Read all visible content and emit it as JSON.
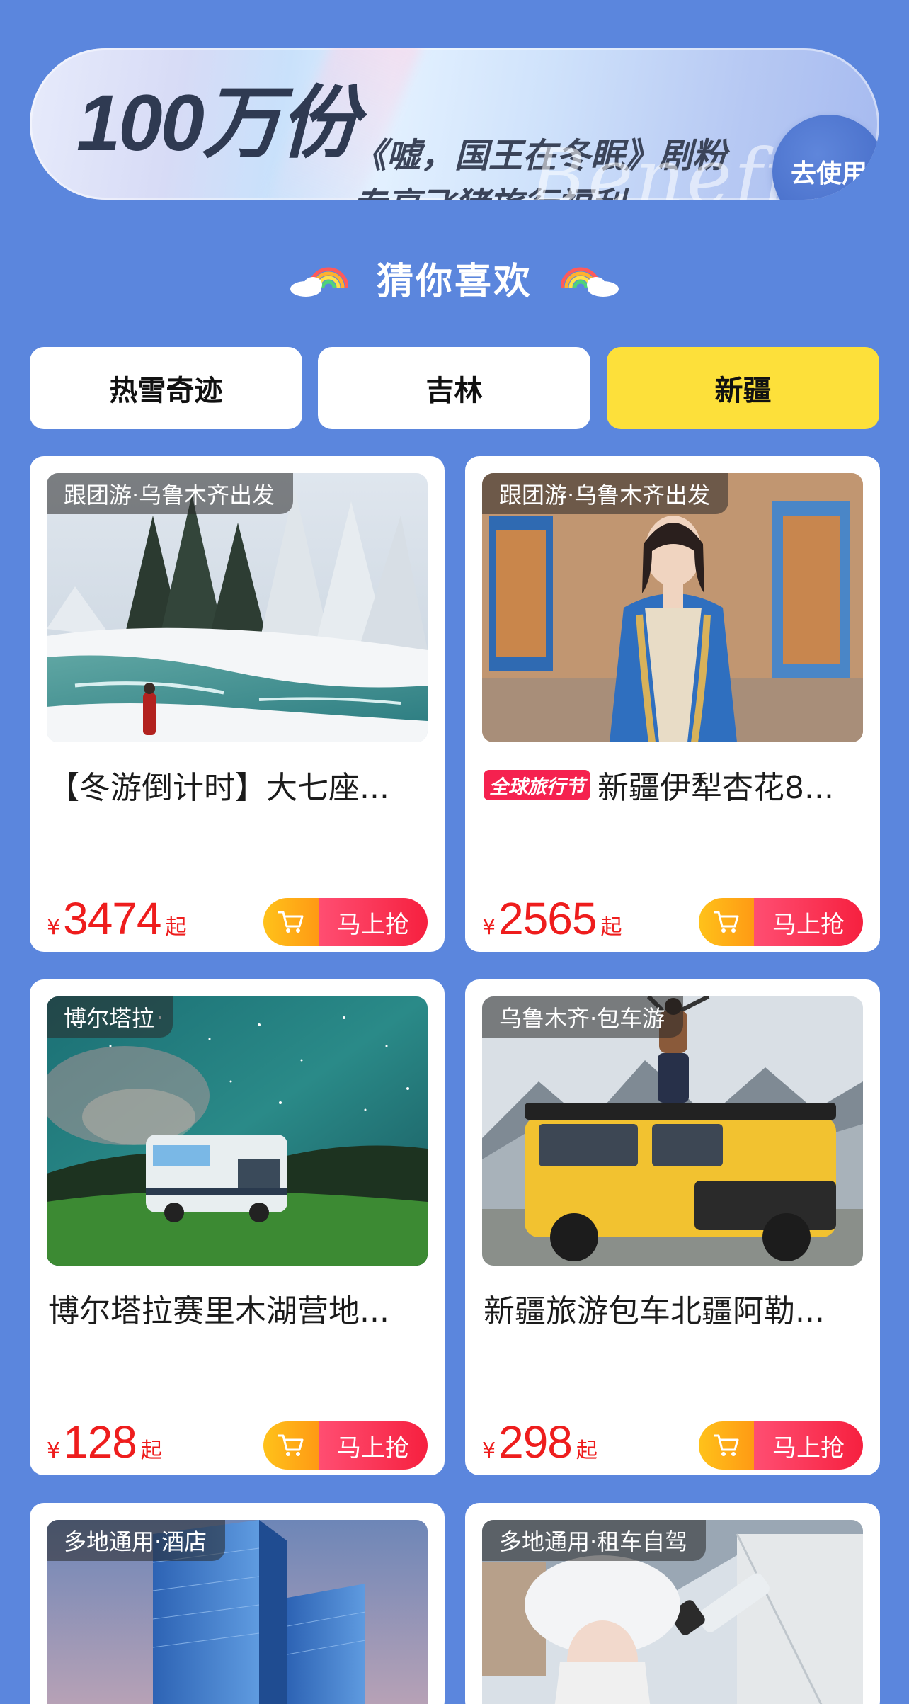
{
  "promo": {
    "big_text": "100万份",
    "line1": "《嘘，国王在冬眠》剧粉",
    "line2": "专享飞猪旅行福利",
    "script_text": "Benefit",
    "button_label": "去使用"
  },
  "section": {
    "title": "猜你喜欢"
  },
  "tabs": [
    {
      "label": "热雪奇迹",
      "active": false
    },
    {
      "label": "吉林",
      "active": false
    },
    {
      "label": "新疆",
      "active": true
    }
  ],
  "cards": [
    {
      "tag": "跟团游·乌鲁木齐出发",
      "badge": "",
      "title": "【冬游倒计时】大七座...",
      "currency": "¥",
      "price": "3474",
      "suffix": "起",
      "cta": "马上抢",
      "image": "snowy-river-forest"
    },
    {
      "tag": "跟团游·乌鲁木齐出发",
      "badge": "全球旅行节",
      "title": "新疆伊犁杏花8...",
      "currency": "¥",
      "price": "2565",
      "suffix": "起",
      "cta": "马上抢",
      "image": "woman-blue-embroidered-dress"
    },
    {
      "tag": "博尔塔拉",
      "badge": "",
      "title": "博尔塔拉赛里木湖营地...",
      "currency": "¥",
      "price": "128",
      "suffix": "起",
      "cta": "马上抢",
      "image": "rv-under-starry-sky"
    },
    {
      "tag": "乌鲁木齐·包车游",
      "badge": "",
      "title": "新疆旅游包车北疆阿勒...",
      "currency": "¥",
      "price": "298",
      "suffix": "起",
      "cta": "马上抢",
      "image": "yellow-offroad-suv-mountains"
    },
    {
      "tag": "多地通用·酒店",
      "badge": "",
      "title": "",
      "currency": "",
      "price": "",
      "suffix": "",
      "cta": "",
      "image": "glass-hotel-towers"
    },
    {
      "tag": "多地通用·租车自驾",
      "badge": "",
      "title": "",
      "currency": "",
      "price": "",
      "suffix": "",
      "cta": "",
      "image": "woman-fur-hat-telescope"
    }
  ],
  "colors": {
    "background": "#5b86dd",
    "active_tab": "#fde03a",
    "price": "#ee1d1d",
    "cta_gradient": [
      "#ff4e72",
      "#f6203f"
    ],
    "cart_gradient": [
      "#ffc21a",
      "#ff9a14"
    ],
    "promo_button": "#4a70cc"
  },
  "icons": [
    "rainbow-cloud-icon",
    "cart-icon"
  ]
}
